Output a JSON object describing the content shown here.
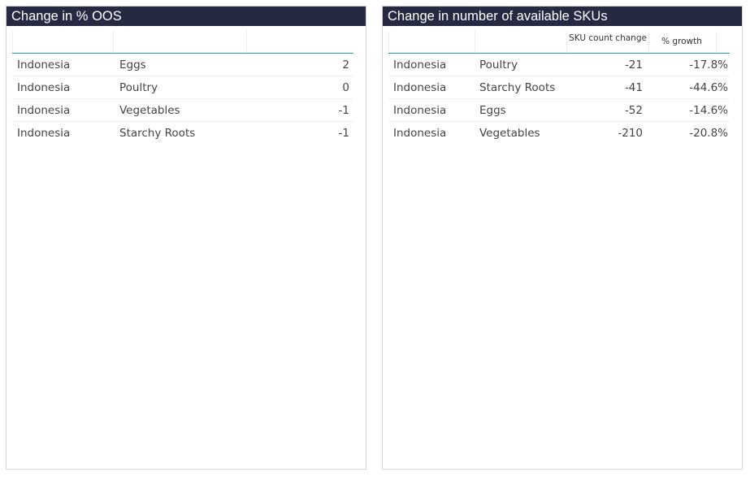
{
  "left_panel": {
    "title": "Change in % OOS",
    "rows": [
      {
        "country": "Indonesia",
        "category": "Eggs",
        "value": "2"
      },
      {
        "country": "Indonesia",
        "category": "Poultry",
        "value": "0"
      },
      {
        "country": "Indonesia",
        "category": "Vegetables",
        "value": "-1"
      },
      {
        "country": "Indonesia",
        "category": "Starchy Roots",
        "value": "-1"
      }
    ]
  },
  "right_panel": {
    "title": "Change in number of available SKUs",
    "headers": {
      "sku_count_change": "SKU count change",
      "pct_growth": "% growth"
    },
    "rows": [
      {
        "country": "Indonesia",
        "category": "Poultry",
        "sku_change": "-21",
        "growth": "-17.8%"
      },
      {
        "country": "Indonesia",
        "category": "Starchy Roots",
        "sku_change": "-41",
        "growth": "-44.6%"
      },
      {
        "country": "Indonesia",
        "category": "Eggs",
        "sku_change": "-52",
        "growth": "-14.6%"
      },
      {
        "country": "Indonesia",
        "category": "Vegetables",
        "sku_change": "-210",
        "growth": "-20.8%"
      }
    ]
  },
  "colors": {
    "header_bg": "#252941",
    "accent_line": "#23a08c"
  }
}
